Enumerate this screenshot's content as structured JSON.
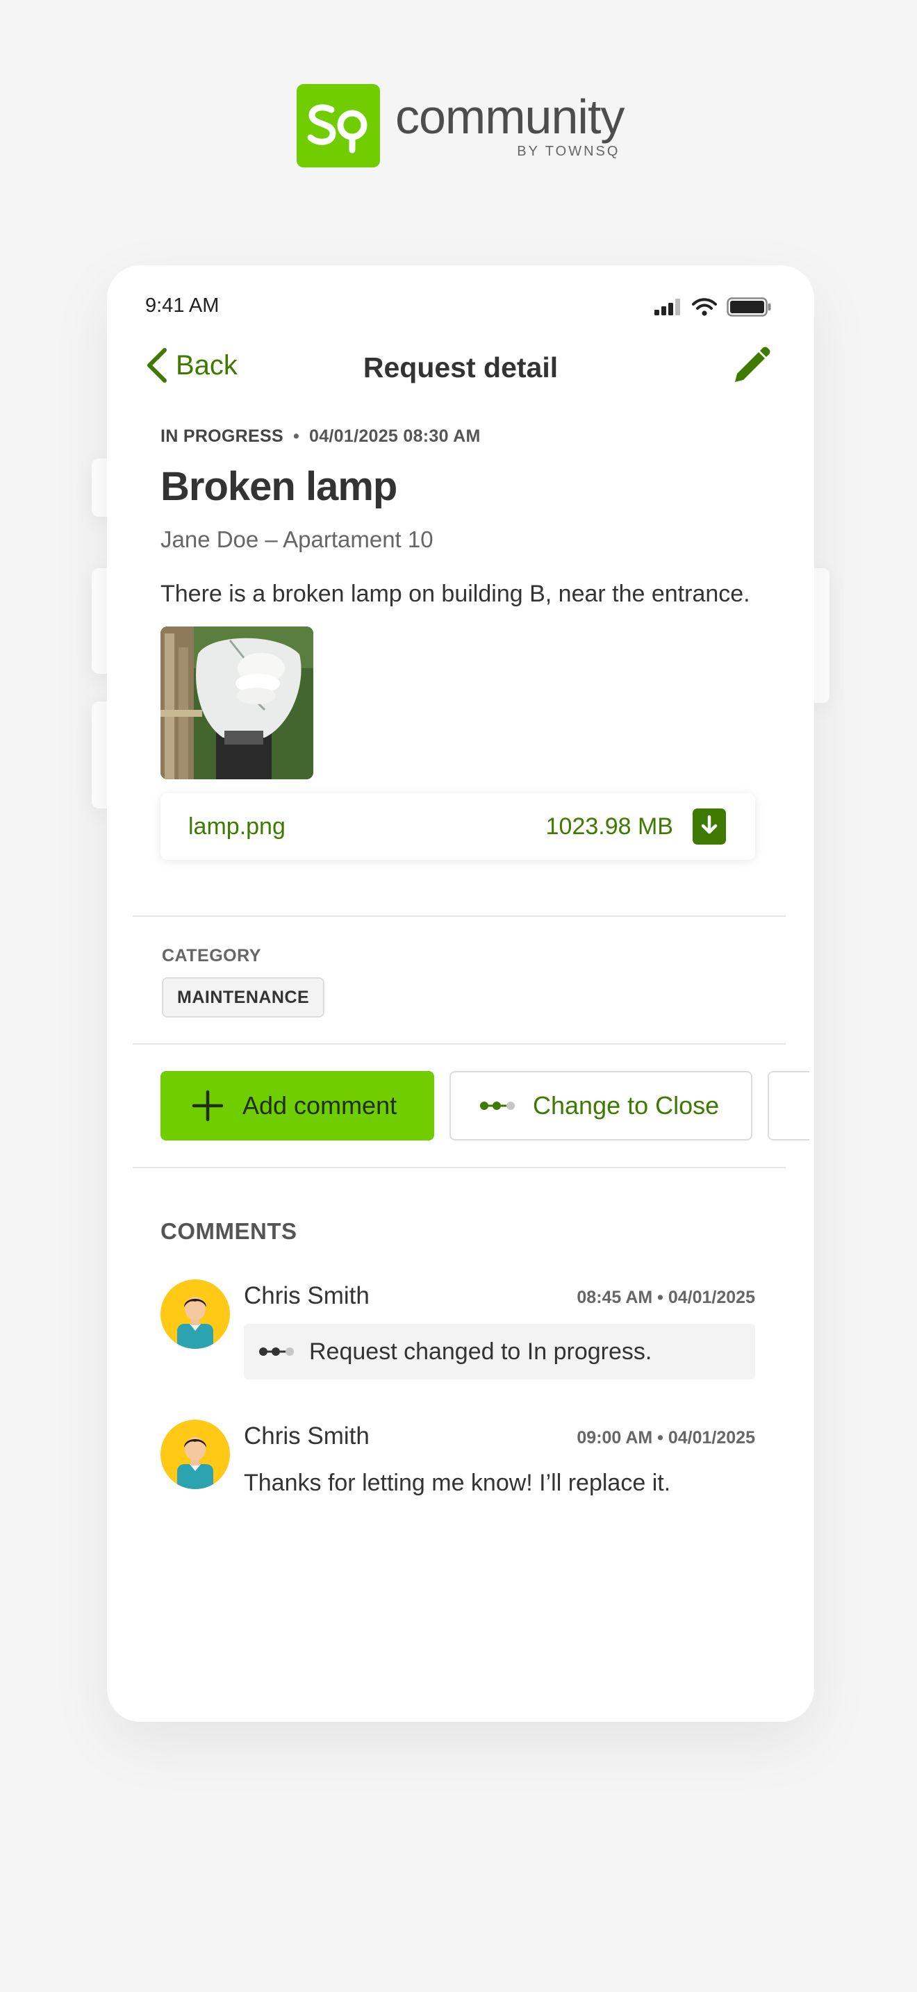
{
  "brand": {
    "name": "community",
    "byline": "BY TOWNSQ",
    "mark": "Sq",
    "accent": "#6fcd00",
    "dark_green": "#3f7a00"
  },
  "status_bar": {
    "time": "9:41 AM",
    "icons": [
      "cellular-signal-icon",
      "wifi-icon",
      "battery-icon"
    ]
  },
  "nav": {
    "back_label": "Back",
    "title": "Request detail",
    "edit_icon": "pencil-icon"
  },
  "request": {
    "status": "IN PROGRESS",
    "datetime": "04/01/2025 08:30 AM",
    "title": "Broken lamp",
    "author_line": "Jane Doe – Apartament 10",
    "description": "There is a broken lamp on building B, near the entrance.",
    "attachment": {
      "name": "lamp.png",
      "size": "1023.98 MB",
      "icon": "download-icon"
    }
  },
  "category": {
    "label": "CATEGORY",
    "value": "MAINTENANCE"
  },
  "actions": {
    "add_comment": "Add comment",
    "change_status": "Change to Close"
  },
  "comments": {
    "title": "COMMENTS",
    "items": [
      {
        "author": "Chris Smith",
        "time": "08:45 AM • 04/01/2025",
        "type": "status-change",
        "text": "Request changed to In progress."
      },
      {
        "author": "Chris Smith",
        "time": "09:00 AM • 04/01/2025",
        "type": "text",
        "text": "Thanks for letting me know! I’ll replace it."
      }
    ]
  }
}
